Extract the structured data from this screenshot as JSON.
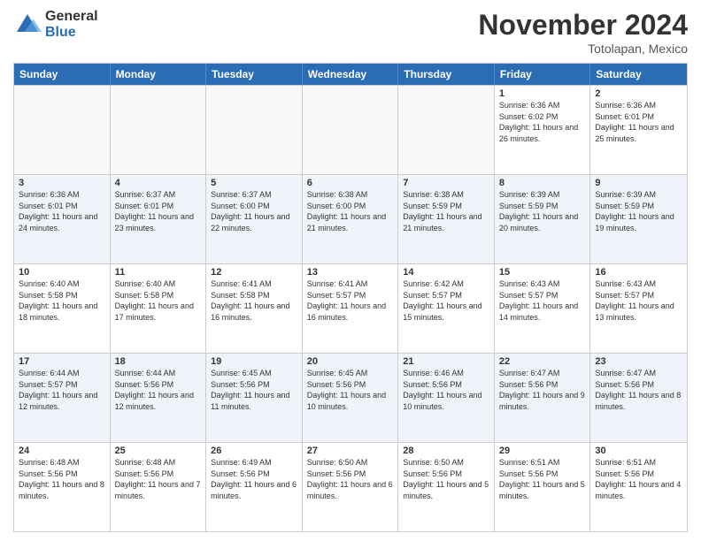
{
  "logo": {
    "general": "General",
    "blue": "Blue"
  },
  "header": {
    "month": "November 2024",
    "location": "Totolapan, Mexico"
  },
  "days_of_week": [
    "Sunday",
    "Monday",
    "Tuesday",
    "Wednesday",
    "Thursday",
    "Friday",
    "Saturday"
  ],
  "rows": [
    {
      "cells": [
        {
          "day": "",
          "info": ""
        },
        {
          "day": "",
          "info": ""
        },
        {
          "day": "",
          "info": ""
        },
        {
          "day": "",
          "info": ""
        },
        {
          "day": "",
          "info": ""
        },
        {
          "day": "1",
          "info": "Sunrise: 6:36 AM\nSunset: 6:02 PM\nDaylight: 11 hours and 26 minutes."
        },
        {
          "day": "2",
          "info": "Sunrise: 6:36 AM\nSunset: 6:01 PM\nDaylight: 11 hours and 25 minutes."
        }
      ]
    },
    {
      "cells": [
        {
          "day": "3",
          "info": "Sunrise: 6:36 AM\nSunset: 6:01 PM\nDaylight: 11 hours and 24 minutes."
        },
        {
          "day": "4",
          "info": "Sunrise: 6:37 AM\nSunset: 6:01 PM\nDaylight: 11 hours and 23 minutes."
        },
        {
          "day": "5",
          "info": "Sunrise: 6:37 AM\nSunset: 6:00 PM\nDaylight: 11 hours and 22 minutes."
        },
        {
          "day": "6",
          "info": "Sunrise: 6:38 AM\nSunset: 6:00 PM\nDaylight: 11 hours and 21 minutes."
        },
        {
          "day": "7",
          "info": "Sunrise: 6:38 AM\nSunset: 5:59 PM\nDaylight: 11 hours and 21 minutes."
        },
        {
          "day": "8",
          "info": "Sunrise: 6:39 AM\nSunset: 5:59 PM\nDaylight: 11 hours and 20 minutes."
        },
        {
          "day": "9",
          "info": "Sunrise: 6:39 AM\nSunset: 5:59 PM\nDaylight: 11 hours and 19 minutes."
        }
      ]
    },
    {
      "cells": [
        {
          "day": "10",
          "info": "Sunrise: 6:40 AM\nSunset: 5:58 PM\nDaylight: 11 hours and 18 minutes."
        },
        {
          "day": "11",
          "info": "Sunrise: 6:40 AM\nSunset: 5:58 PM\nDaylight: 11 hours and 17 minutes."
        },
        {
          "day": "12",
          "info": "Sunrise: 6:41 AM\nSunset: 5:58 PM\nDaylight: 11 hours and 16 minutes."
        },
        {
          "day": "13",
          "info": "Sunrise: 6:41 AM\nSunset: 5:57 PM\nDaylight: 11 hours and 16 minutes."
        },
        {
          "day": "14",
          "info": "Sunrise: 6:42 AM\nSunset: 5:57 PM\nDaylight: 11 hours and 15 minutes."
        },
        {
          "day": "15",
          "info": "Sunrise: 6:43 AM\nSunset: 5:57 PM\nDaylight: 11 hours and 14 minutes."
        },
        {
          "day": "16",
          "info": "Sunrise: 6:43 AM\nSunset: 5:57 PM\nDaylight: 11 hours and 13 minutes."
        }
      ]
    },
    {
      "cells": [
        {
          "day": "17",
          "info": "Sunrise: 6:44 AM\nSunset: 5:57 PM\nDaylight: 11 hours and 12 minutes."
        },
        {
          "day": "18",
          "info": "Sunrise: 6:44 AM\nSunset: 5:56 PM\nDaylight: 11 hours and 12 minutes."
        },
        {
          "day": "19",
          "info": "Sunrise: 6:45 AM\nSunset: 5:56 PM\nDaylight: 11 hours and 11 minutes."
        },
        {
          "day": "20",
          "info": "Sunrise: 6:45 AM\nSunset: 5:56 PM\nDaylight: 11 hours and 10 minutes."
        },
        {
          "day": "21",
          "info": "Sunrise: 6:46 AM\nSunset: 5:56 PM\nDaylight: 11 hours and 10 minutes."
        },
        {
          "day": "22",
          "info": "Sunrise: 6:47 AM\nSunset: 5:56 PM\nDaylight: 11 hours and 9 minutes."
        },
        {
          "day": "23",
          "info": "Sunrise: 6:47 AM\nSunset: 5:56 PM\nDaylight: 11 hours and 8 minutes."
        }
      ]
    },
    {
      "cells": [
        {
          "day": "24",
          "info": "Sunrise: 6:48 AM\nSunset: 5:56 PM\nDaylight: 11 hours and 8 minutes."
        },
        {
          "day": "25",
          "info": "Sunrise: 6:48 AM\nSunset: 5:56 PM\nDaylight: 11 hours and 7 minutes."
        },
        {
          "day": "26",
          "info": "Sunrise: 6:49 AM\nSunset: 5:56 PM\nDaylight: 11 hours and 6 minutes."
        },
        {
          "day": "27",
          "info": "Sunrise: 6:50 AM\nSunset: 5:56 PM\nDaylight: 11 hours and 6 minutes."
        },
        {
          "day": "28",
          "info": "Sunrise: 6:50 AM\nSunset: 5:56 PM\nDaylight: 11 hours and 5 minutes."
        },
        {
          "day": "29",
          "info": "Sunrise: 6:51 AM\nSunset: 5:56 PM\nDaylight: 11 hours and 5 minutes."
        },
        {
          "day": "30",
          "info": "Sunrise: 6:51 AM\nSunset: 5:56 PM\nDaylight: 11 hours and 4 minutes."
        }
      ]
    }
  ]
}
